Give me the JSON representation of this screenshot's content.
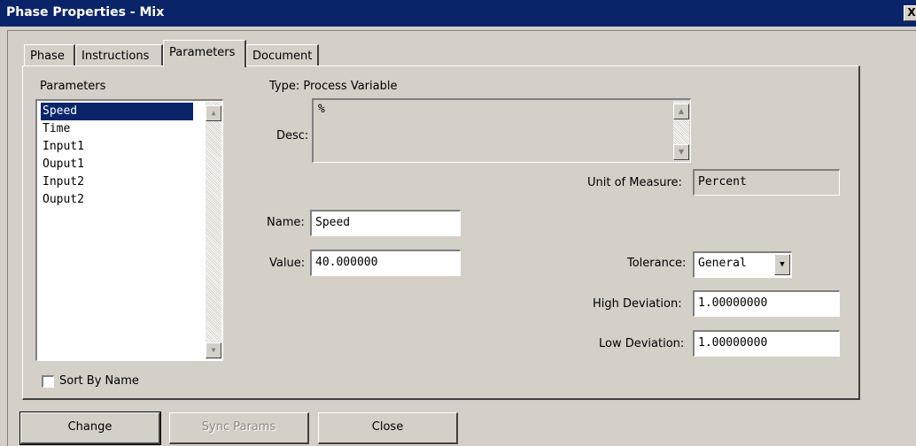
{
  "window": {
    "title": "Phase Properties - Mix",
    "close_glyph": "X"
  },
  "tabs": [
    {
      "label": "Phase"
    },
    {
      "label": "Instructions"
    },
    {
      "label": "Parameters",
      "active": true
    },
    {
      "label": "Document"
    }
  ],
  "parameters": {
    "heading": "Parameters",
    "items": [
      "Speed",
      "Time",
      "Input1",
      "Ouput1",
      "Input2",
      "Ouput2"
    ],
    "selected": "Speed",
    "sort_by_name": {
      "label": "Sort By Name",
      "checked": false
    }
  },
  "details": {
    "type_text": "Type: Process Variable",
    "desc_label": "Desc:",
    "desc_value": "%",
    "uom_label": "Unit of Measure:",
    "uom_value": "Percent",
    "name_label": "Name:",
    "name_value": "Speed",
    "value_label": "Value:",
    "value_value": "40.000000",
    "tolerance_label": "Tolerance:",
    "tolerance_value": "General",
    "high_dev_label": "High Deviation:",
    "high_dev_value": "1.00000000",
    "low_dev_label": "Low Deviation:",
    "low_dev_value": "1.00000000"
  },
  "buttons": {
    "change": "Change",
    "sync_params": "Sync Params",
    "close": "Close"
  },
  "colors": {
    "title_bar": "#0a246a",
    "face": "#d4d0c8",
    "selection": "#0a246a"
  }
}
